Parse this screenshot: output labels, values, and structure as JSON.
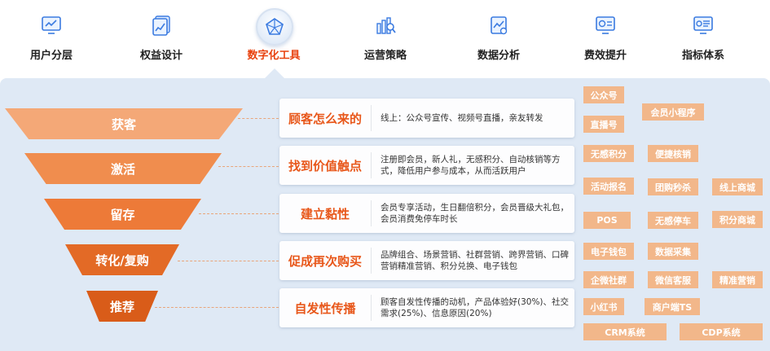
{
  "nav": {
    "items": [
      {
        "label": "用户分层",
        "icon": "monitor-chart-icon"
      },
      {
        "label": "权益设计",
        "icon": "document-chart-icon"
      },
      {
        "label": "数字化工具",
        "icon": "pentagon-network-icon"
      },
      {
        "label": "运营策略",
        "icon": "bar-chart-search-icon"
      },
      {
        "label": "数据分析",
        "icon": "analysis-report-icon"
      },
      {
        "label": "费效提升",
        "icon": "dashboard-screen-icon"
      },
      {
        "label": "指标体系",
        "icon": "indicator-screen-icon"
      }
    ],
    "active_index": 2
  },
  "funnel": {
    "stages": [
      "获客",
      "激活",
      "留存",
      "转化/复购",
      "推荐"
    ],
    "colors": [
      "#f4a877",
      "#f08d4e",
      "#ed7a38",
      "#e36a26",
      "#d95c19"
    ]
  },
  "cards": [
    {
      "title": "顾客怎么来的",
      "desc": "线上：公众号宣传、视频号直播，亲友转发"
    },
    {
      "title": "找到价值触点",
      "desc": "注册即会员，新人礼，无感积分、自动核销等方式，降低用户参与成本，从而活跃用户"
    },
    {
      "title": "建立黏性",
      "desc": "会员专享活动，生日翻倍积分，会员晋级大礼包，会员消费免停车时长"
    },
    {
      "title": "促成再次购买",
      "desc": "品牌组合、场景营销、社群营销、跨界营销、口碑营销精准营销、积分兑换、电子钱包"
    },
    {
      "title": "自发性传播",
      "desc": "顾客自发性传播的动机，产品体验好(30%)、社交需求(25%)、信息原因(20%)"
    }
  ],
  "tags": [
    "公众号",
    "会员小程序",
    "直播号",
    "无感积分",
    "便捷核销",
    "活动报名",
    "团购秒杀",
    "线上商城",
    "POS",
    "无感停车",
    "积分商城",
    "电子钱包",
    "数据采集",
    "企微社群",
    "微信客服",
    "精准营销",
    "小红书",
    "商户端TS",
    "CRM系统",
    "CDP系统"
  ],
  "colors": {
    "accent": "#e8420f",
    "panel": "#dfe9f5",
    "tag": "#f2b78a",
    "card_title": "#e8571a"
  }
}
